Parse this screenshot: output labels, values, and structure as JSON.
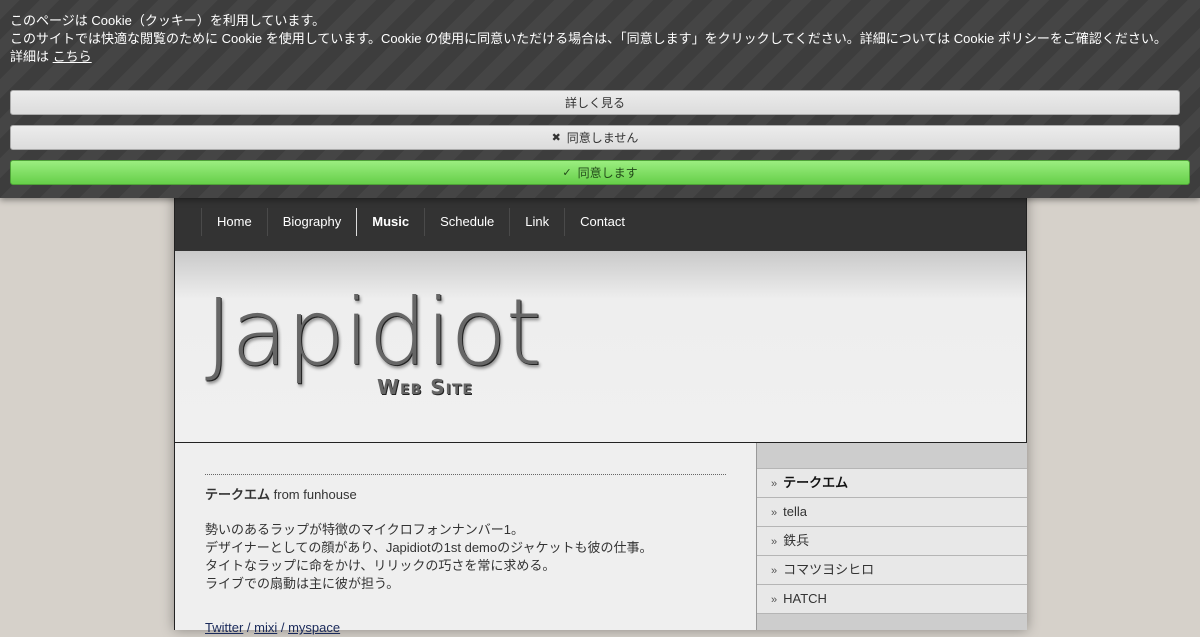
{
  "cookie": {
    "line1": "このページは Cookie（クッキー）を利用しています。",
    "line2": "このサイトでは快適な閲覧のために Cookie を使用しています。Cookie の使用に同意いただける場合は、「同意します」をクリックしてください。詳細については Cookie ポリシーをご確認ください。",
    "details_prefix": "詳細は",
    "details_link": "こちら",
    "learn_more": "詳しく見る",
    "decline": "同意しません",
    "accept": "同意します",
    "decline_icon": "✖",
    "accept_icon": "✓"
  },
  "nav": {
    "items": [
      {
        "label": "Home"
      },
      {
        "label": "Biography"
      },
      {
        "label": "Music"
      },
      {
        "label": "Schedule"
      },
      {
        "label": "Link"
      },
      {
        "label": "Contact"
      }
    ],
    "active": "Music"
  },
  "header": {
    "logo_main": "Japidiot",
    "logo_sub": "Web Site"
  },
  "content": {
    "member_name": "テークエム",
    "member_from": " from funhouse",
    "desc": [
      "勢いのあるラップが特徴のマイクロフォンナンバー1。",
      "デザイナーとしての顔があり、Japidiotの1st demoのジャケットも彼の仕事。",
      "タイトなラップに命をかけ、リリックの巧さを常に求める。",
      "ライブでの扇動は主に彼が担う。"
    ],
    "links": {
      "twitter": "Twitter",
      "mixi": "mixi",
      "myspace": "myspace",
      "separator": " / "
    }
  },
  "sidebar": {
    "items": [
      {
        "label": "テークエム"
      },
      {
        "label": "tella"
      },
      {
        "label": "鉄兵"
      },
      {
        "label": "コマツヨシヒロ"
      },
      {
        "label": "HATCH"
      }
    ],
    "active": "テークエム",
    "chevron": "»"
  }
}
